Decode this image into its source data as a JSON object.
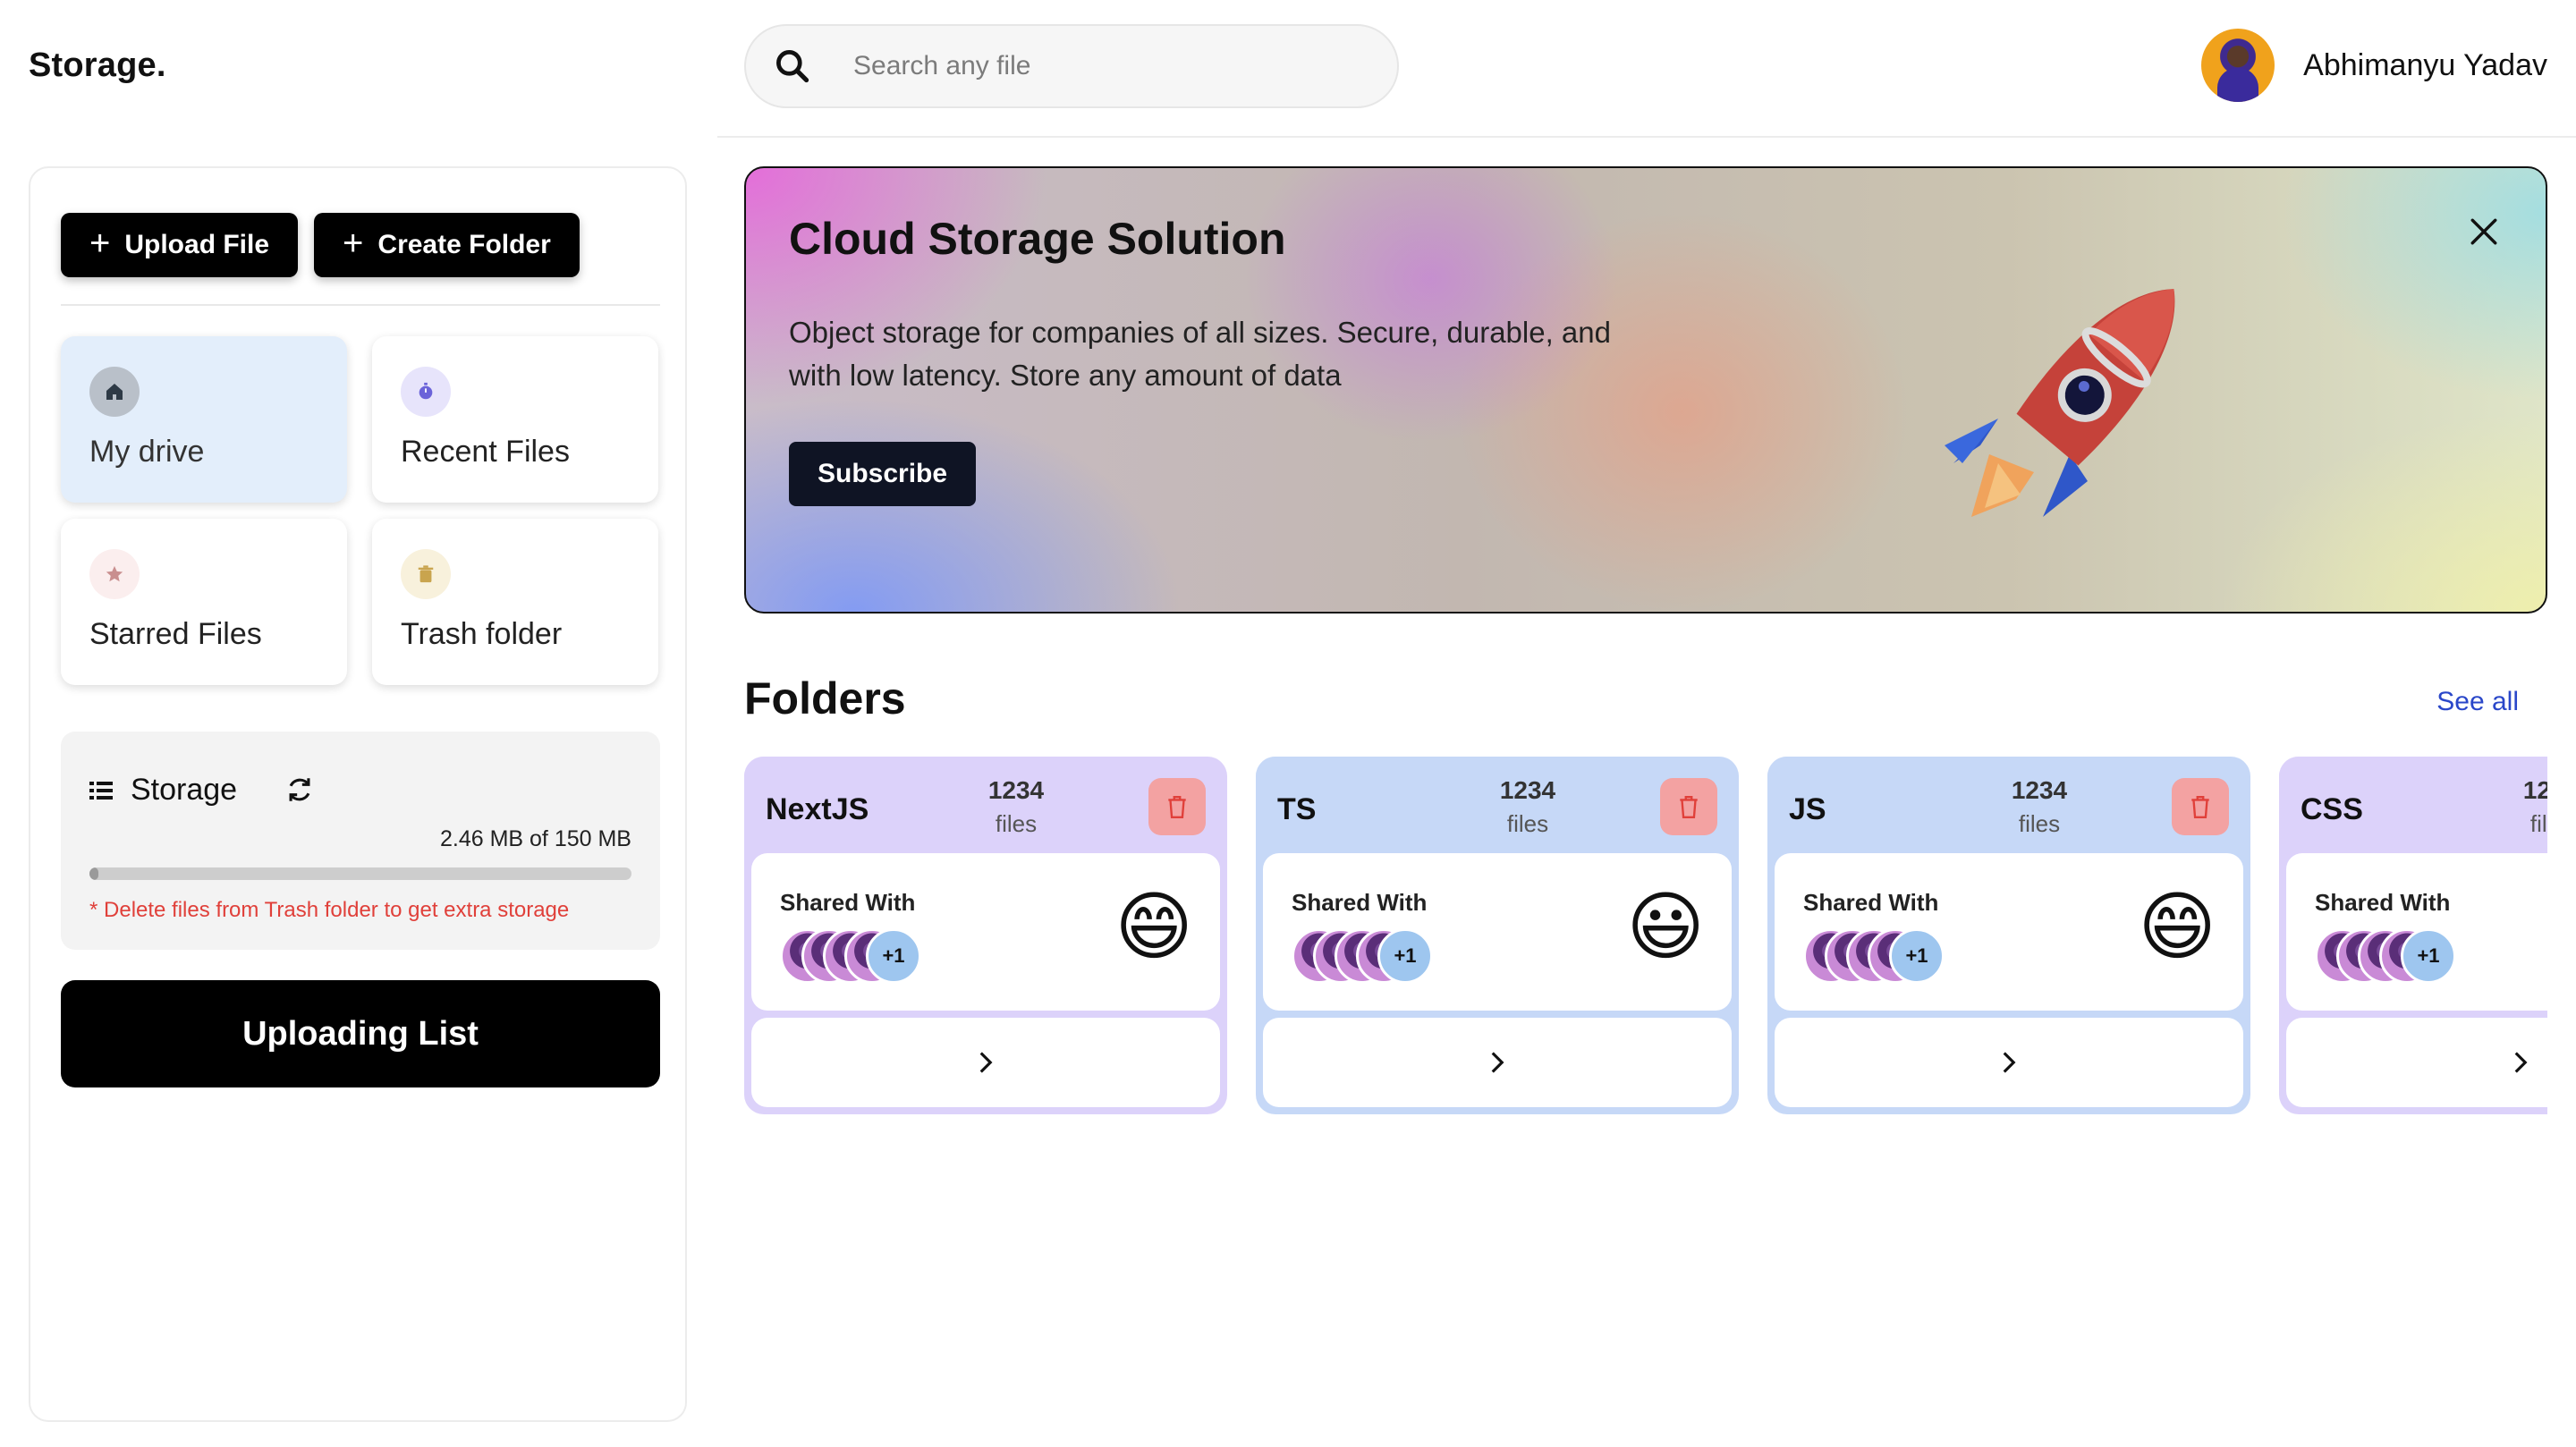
{
  "app": {
    "brand": "Storage."
  },
  "search": {
    "placeholder": "Search any file"
  },
  "user": {
    "name": "Abhimanyu Yadav"
  },
  "sidebar": {
    "upload_label": "Upload File",
    "create_folder_label": "Create Folder",
    "nav": [
      {
        "label": "My drive",
        "icon": "home-icon",
        "active": true
      },
      {
        "label": "Recent Files",
        "icon": "clock-icon",
        "active": false
      },
      {
        "label": "Starred Files",
        "icon": "star-icon",
        "active": false
      },
      {
        "label": "Trash folder",
        "icon": "trash-icon",
        "active": false
      }
    ],
    "storage": {
      "title": "Storage",
      "usage": "2.46 MB of 150 MB",
      "used_fraction": 0.0164,
      "note": "* Delete files from Trash folder to get extra storage"
    },
    "uploading_list_label": "Uploading List"
  },
  "banner": {
    "title": "Cloud Storage Solution",
    "description": "Object storage for companies of all sizes. Secure, durable, and with low latency. Store any amount of data",
    "subscribe_label": "Subscribe"
  },
  "folders": {
    "title": "Folders",
    "see_all_label": "See all",
    "items": [
      {
        "name": "NextJS",
        "count": "1234",
        "count_label": "files",
        "shared_label": "Shared With",
        "more": "+1",
        "emoji": "😄",
        "color": "#dcd2fa"
      },
      {
        "name": "TS",
        "count": "1234",
        "count_label": "files",
        "shared_label": "Shared With",
        "more": "+1",
        "emoji": "😃",
        "color": "#c6d8f7"
      },
      {
        "name": "JS",
        "count": "1234",
        "count_label": "files",
        "shared_label": "Shared With",
        "more": "+1",
        "emoji": "😄",
        "color": "#c6d8f7"
      },
      {
        "name": "CSS",
        "count": "1234",
        "count_label": "files",
        "shared_label": "Shared With",
        "more": "+1",
        "emoji": "😄",
        "color": "#dcd2fa"
      }
    ]
  },
  "colors": {
    "accent_link": "#2a47c9",
    "danger": "#e0403a",
    "active_nav": "#e3eefb",
    "button_dark": "#000000"
  }
}
